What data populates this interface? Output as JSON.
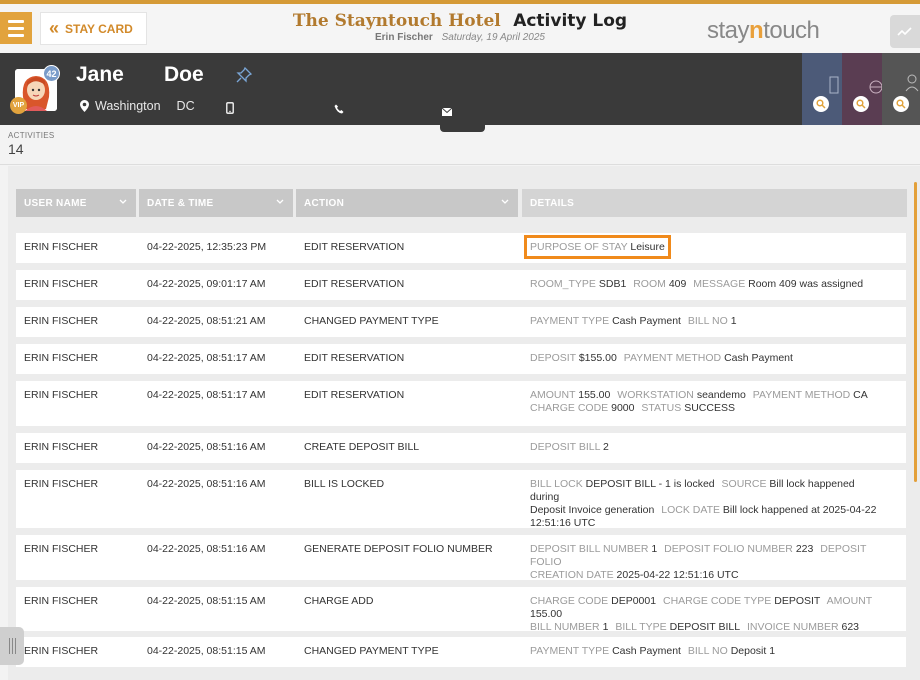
{
  "header": {
    "stay_card_label": "STAY CARD",
    "hotel_name": "The Stayntouch Hotel",
    "page_title": "Activity Log",
    "user": "Erin Fischer",
    "date": "Saturday, 19 April 2025",
    "logo_prefix": "stay",
    "logo_n": "n",
    "logo_suffix": "touch",
    "accent": "#e2a33d"
  },
  "guest": {
    "first_name": "Jane",
    "last_name": "Doe",
    "badge_count": "42",
    "vip": "VIP",
    "city": "Washington",
    "state": "DC"
  },
  "activities": {
    "label": "ACTIVITIES",
    "count": "14"
  },
  "columns": {
    "user": "USER NAME",
    "date": "DATE & TIME",
    "action": "ACTION",
    "details": "DETAILS"
  },
  "rows": [
    {
      "user": "ERIN FISCHER",
      "date": "04-22-2025, 12:35:23 PM",
      "action": "EDIT RESERVATION",
      "k1": "PURPOSE OF STAY",
      "v1": "Leisure"
    },
    {
      "user": "ERIN FISCHER",
      "date": "04-22-2025, 09:01:17 AM",
      "action": "EDIT RESERVATION",
      "k1": "ROOM_TYPE",
      "v1": "SDB1",
      "k2": "ROOM",
      "v2": "409",
      "k3": "MESSAGE",
      "v3": "Room 409 was assigned"
    },
    {
      "user": "ERIN FISCHER",
      "date": "04-22-2025, 08:51:21 AM",
      "action": "CHANGED PAYMENT TYPE",
      "k1": "PAYMENT TYPE",
      "v1": "Cash Payment",
      "k2": "BILL NO",
      "v2": "1"
    },
    {
      "user": "ERIN FISCHER",
      "date": "04-22-2025, 08:51:17 AM",
      "action": "EDIT RESERVATION",
      "k1": "DEPOSIT",
      "v1": "$155.00",
      "k2": "PAYMENT METHOD",
      "v2": "Cash Payment"
    },
    {
      "user": "ERIN FISCHER",
      "date": "04-22-2025, 08:51:17 AM",
      "action": "EDIT RESERVATION",
      "k1": "AMOUNT",
      "v1": "155.00",
      "k2": "WORKSTATION",
      "v2": "seandemo",
      "k3": "PAYMENT METHOD",
      "v3": "CA",
      "k4": "CHARGE CODE",
      "v4": "9000",
      "k5": "STATUS",
      "v5": "SUCCESS"
    },
    {
      "user": "ERIN FISCHER",
      "date": "04-22-2025, 08:51:16 AM",
      "action": "CREATE DEPOSIT BILL",
      "k1": "DEPOSIT BILL",
      "v1": "2"
    },
    {
      "user": "ERIN FISCHER",
      "date": "04-22-2025, 08:51:16 AM",
      "action": "BILL IS LOCKED",
      "k1": "BILL LOCK",
      "v1": "DEPOSIT BILL - 1 is locked",
      "k2": "SOURCE",
      "v2a": "Bill lock happened during",
      "v2b": "Deposit Invoice generation",
      "k3": "LOCK DATE",
      "v3a": "Bill lock happened at 2025-04-22",
      "v3b": "12:51:16 UTC"
    },
    {
      "user": "ERIN FISCHER",
      "date": "04-22-2025, 08:51:16 AM",
      "action": "GENERATE DEPOSIT FOLIO NUMBER",
      "k1": "DEPOSIT BILL NUMBER",
      "v1": "1",
      "k2": "DEPOSIT FOLIO NUMBER",
      "v2": "223",
      "k3a": "DEPOSIT FOLIO",
      "k3b": "CREATION DATE",
      "v3": "2025-04-22 12:51:16 UTC"
    },
    {
      "user": "ERIN FISCHER",
      "date": "04-22-2025, 08:51:15 AM",
      "action": "CHARGE ADD",
      "k1": "CHARGE CODE",
      "v1": "DEP0001",
      "k2": "CHARGE CODE TYPE",
      "v2": "DEPOSIT",
      "k3": "AMOUNT",
      "v3": "155.00",
      "k4": "BILL NUMBER",
      "v4": "1",
      "k5": "BILL TYPE",
      "v5": "DEPOSIT BILL",
      "k6": "INVOICE NUMBER",
      "v6": "623"
    },
    {
      "user": "ERIN FISCHER",
      "date": "04-22-2025, 08:51:15 AM",
      "action": "CHANGED PAYMENT TYPE",
      "k1": "PAYMENT TYPE",
      "v1": "Cash Payment",
      "k2": "BILL NO",
      "v2": "Deposit 1"
    }
  ]
}
